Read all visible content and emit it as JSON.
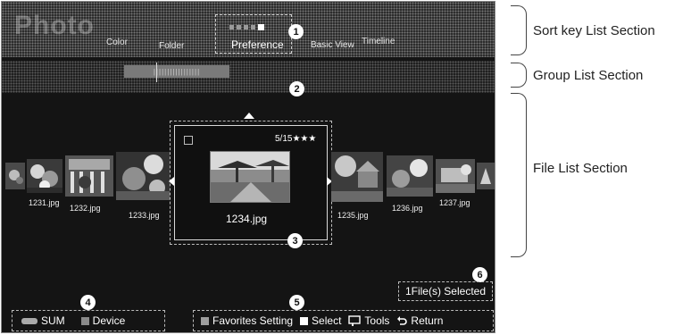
{
  "app_title": "Photo",
  "sort_keys": {
    "items": [
      "Color",
      "Folder",
      "Preference",
      "Basic View",
      "Timeline"
    ],
    "selected": "Preference"
  },
  "group_list": {
    "label": "|||||||||||||||||"
  },
  "files": [
    {
      "name": "1231.jpg"
    },
    {
      "name": "1232.jpg"
    },
    {
      "name": "1233.jpg"
    },
    {
      "name": "1234.jpg"
    },
    {
      "name": "1235.jpg"
    },
    {
      "name": "1236.jpg"
    },
    {
      "name": "1237.jpg"
    }
  ],
  "selected_file": {
    "name": "1234.jpg",
    "rating_text": "5/15★★★"
  },
  "selection_status": "1File(s) Selected",
  "bottom_left": {
    "sum_label": "SUM",
    "device_label": "Device"
  },
  "bottom_right": {
    "favorites_label": "Favorites Setting",
    "select_label": "Select",
    "tools_label": "Tools",
    "return_label": "Return"
  },
  "callouts": [
    "1",
    "2",
    "3",
    "4",
    "5",
    "6"
  ],
  "sections": {
    "sort_key": "Sort key List Section",
    "group": "Group List Section",
    "file": "File List Section"
  },
  "colors": {
    "favorites_key": "#9e9e9e",
    "select_key": "#ffffff",
    "device_key": "#8a8a8a"
  }
}
